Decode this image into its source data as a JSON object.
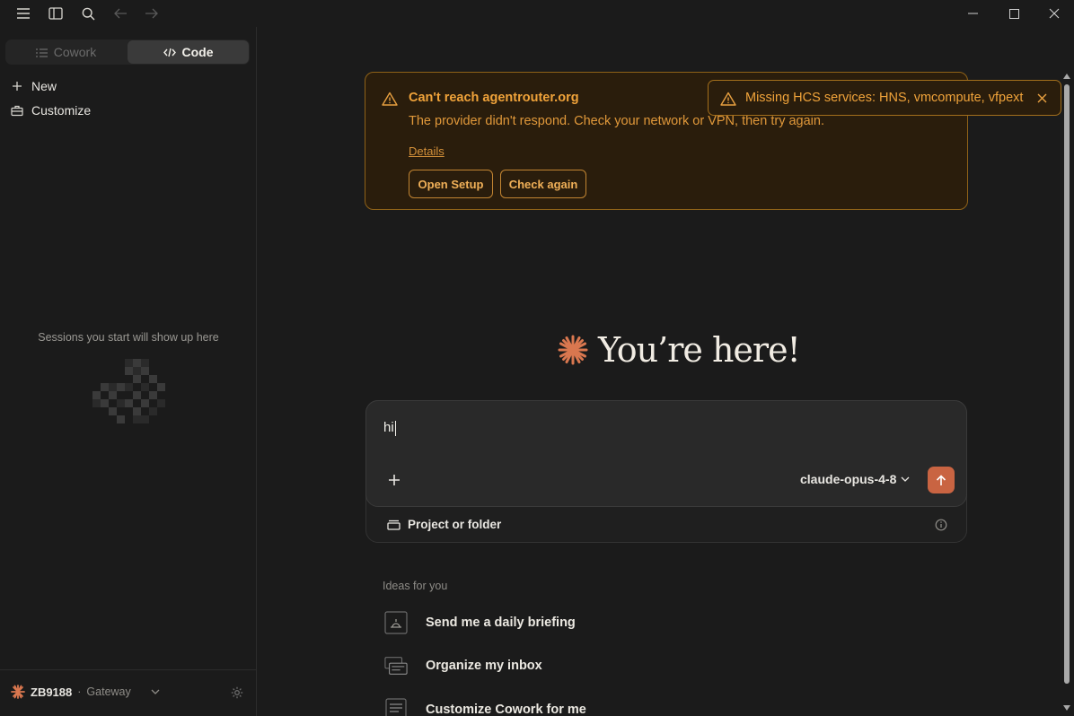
{
  "titlebar": {
    "icons": [
      "menu-icon",
      "sidebar-toggle-icon",
      "search-icon",
      "back-arrow-icon",
      "forward-arrow-icon"
    ],
    "window_controls": [
      "minimize",
      "maximize",
      "close"
    ]
  },
  "sidebar": {
    "modes": [
      {
        "label": "Cowork",
        "active": false
      },
      {
        "label": "Code",
        "active": true
      }
    ],
    "items": [
      {
        "label": "New",
        "icon": "plus-icon"
      },
      {
        "label": "Customize",
        "icon": "briefcase-icon"
      }
    ],
    "empty_state": "Sessions you start will show up here",
    "account": {
      "name": "ZB9188",
      "separator": "·",
      "plan": "Gateway"
    }
  },
  "alert": {
    "title": "Can't reach agentrouter.org",
    "message": "The provider didn't respond. Check your network or VPN, then try again.",
    "details_link": "Details",
    "buttons": {
      "open_setup": "Open Setup",
      "check_again": "Check again"
    }
  },
  "toast": {
    "message": "Missing HCS services: HNS, vmcompute, vfpext"
  },
  "hero": {
    "title": "You’re here!"
  },
  "composer": {
    "input_value": "hi",
    "model": "claude-opus-4-8",
    "project_label": "Project or folder"
  },
  "ideas": {
    "label": "Ideas for you",
    "items": [
      {
        "label": "Send me a daily briefing",
        "icon": "briefing-icon"
      },
      {
        "label": "Organize my inbox",
        "icon": "inbox-icon"
      },
      {
        "label": "Customize Cowork for me",
        "icon": "document-icon"
      }
    ]
  },
  "colors": {
    "accent": "#c96442",
    "warning": "#f0a33a",
    "background": "#1b1b1b"
  }
}
